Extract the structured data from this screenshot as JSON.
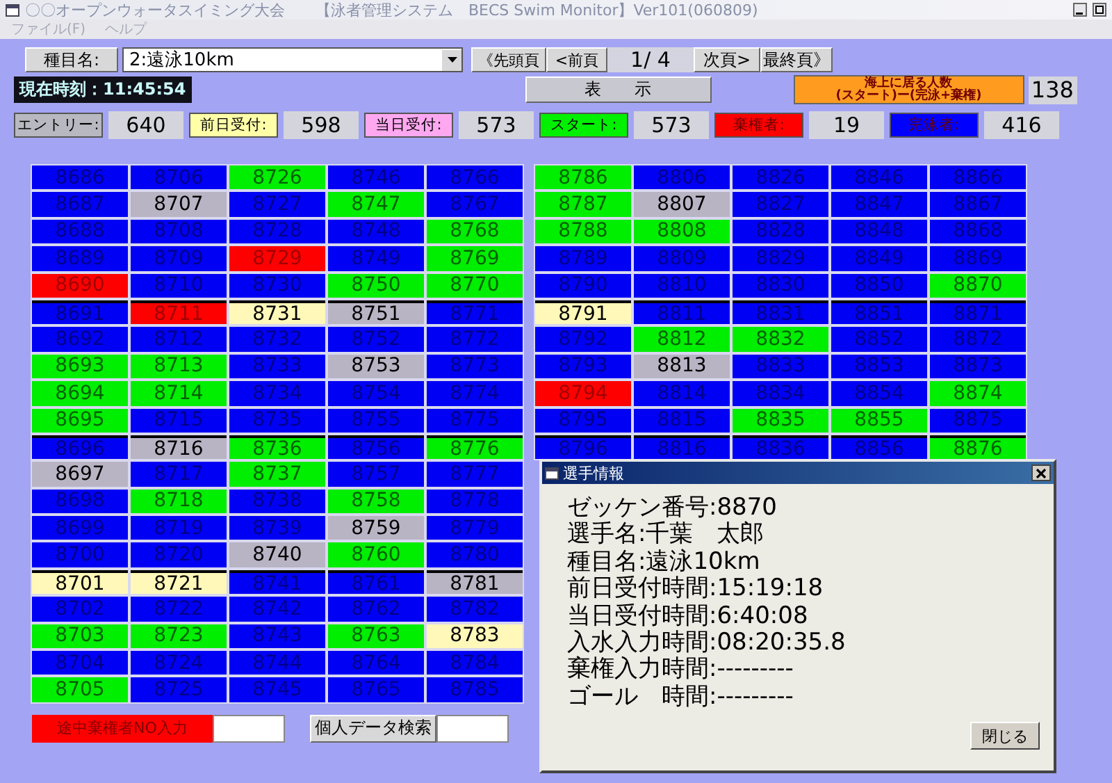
{
  "window": {
    "title": "〇〇オープンウォータスイミング大会　　【泳者管理システム　BECS Swim Monitor】Ver101(060809)"
  },
  "menu": [
    "ファイル(F)",
    "ヘルプ"
  ],
  "event": {
    "label": "種目名:",
    "value": "2:遠泳10km"
  },
  "clock": {
    "label": "現在時刻：",
    "value": "11:45:54"
  },
  "pager": {
    "first": "《先頭頁",
    "prev": "<前頁",
    "page": "1/ 4",
    "next": "次頁>",
    "last": "最終頁》",
    "show": "表　　示"
  },
  "at_sea": {
    "title": "海上に居る人数",
    "subtitle": "(スタート)ー(完泳+棄権)",
    "value": "138"
  },
  "stats": [
    {
      "label": "エントリー:",
      "value": "640",
      "color": "#b8b8c0"
    },
    {
      "label": "前日受付:",
      "value": "598",
      "color": "#ffffa8"
    },
    {
      "label": "当日受付:",
      "value": "573",
      "color": "#ffa8f0"
    },
    {
      "label": "スタート:",
      "value": "573",
      "color": "#00f000"
    },
    {
      "label": "棄権者:",
      "value": "19",
      "color": "#ff0000"
    },
    {
      "label": "完泳者:",
      "value": "416",
      "color": "#0000ff"
    }
  ],
  "grids": [
    {
      "rows": [
        [
          {
            "text": "8686",
            "kind": "finished"
          },
          {
            "text": "8706",
            "kind": "finished"
          },
          {
            "text": "8726",
            "kind": "started"
          },
          {
            "text": "8746",
            "kind": "finished"
          },
          {
            "text": "8766",
            "kind": "finished"
          }
        ],
        [
          {
            "text": "8687",
            "kind": "finished"
          },
          {
            "text": "8707",
            "kind": "entry"
          },
          {
            "text": "8727",
            "kind": "finished"
          },
          {
            "text": "8747",
            "kind": "started"
          },
          {
            "text": "8767",
            "kind": "finished"
          }
        ],
        [
          {
            "text": "8688",
            "kind": "finished"
          },
          {
            "text": "8708",
            "kind": "finished"
          },
          {
            "text": "8728",
            "kind": "finished"
          },
          {
            "text": "8748",
            "kind": "finished"
          },
          {
            "text": "8768",
            "kind": "started"
          }
        ],
        [
          {
            "text": "8689",
            "kind": "finished"
          },
          {
            "text": "8709",
            "kind": "finished"
          },
          {
            "text": "8729",
            "kind": "withdrawn"
          },
          {
            "text": "8749",
            "kind": "finished"
          },
          {
            "text": "8769",
            "kind": "started"
          }
        ],
        [
          {
            "text": "8690",
            "kind": "withdrawn"
          },
          {
            "text": "8710",
            "kind": "finished"
          },
          {
            "text": "8730",
            "kind": "finished"
          },
          {
            "text": "8750",
            "kind": "started"
          },
          {
            "text": "8770",
            "kind": "started"
          }
        ],
        [
          {
            "text": "8691",
            "kind": "finished"
          },
          {
            "text": "8711",
            "kind": "withdrawn"
          },
          {
            "text": "8731",
            "kind": "prev_day"
          },
          {
            "text": "8751",
            "kind": "entry"
          },
          {
            "text": "8771",
            "kind": "finished"
          }
        ],
        [
          {
            "text": "8692",
            "kind": "finished"
          },
          {
            "text": "8712",
            "kind": "finished"
          },
          {
            "text": "8732",
            "kind": "finished"
          },
          {
            "text": "8752",
            "kind": "finished"
          },
          {
            "text": "8772",
            "kind": "finished"
          }
        ],
        [
          {
            "text": "8693",
            "kind": "started"
          },
          {
            "text": "8713",
            "kind": "started"
          },
          {
            "text": "8733",
            "kind": "finished"
          },
          {
            "text": "8753",
            "kind": "entry"
          },
          {
            "text": "8773",
            "kind": "finished"
          }
        ],
        [
          {
            "text": "8694",
            "kind": "started"
          },
          {
            "text": "8714",
            "kind": "started"
          },
          {
            "text": "8734",
            "kind": "finished"
          },
          {
            "text": "8754",
            "kind": "finished"
          },
          {
            "text": "8774",
            "kind": "finished"
          }
        ],
        [
          {
            "text": "8695",
            "kind": "started"
          },
          {
            "text": "8715",
            "kind": "finished"
          },
          {
            "text": "8735",
            "kind": "finished"
          },
          {
            "text": "8755",
            "kind": "finished"
          },
          {
            "text": "8775",
            "kind": "finished"
          }
        ],
        [
          {
            "text": "8696",
            "kind": "finished"
          },
          {
            "text": "8716",
            "kind": "entry"
          },
          {
            "text": "8736",
            "kind": "started"
          },
          {
            "text": "8756",
            "kind": "finished"
          },
          {
            "text": "8776",
            "kind": "started"
          }
        ],
        [
          {
            "text": "8697",
            "kind": "entry"
          },
          {
            "text": "8717",
            "kind": "finished"
          },
          {
            "text": "8737",
            "kind": "started"
          },
          {
            "text": "8757",
            "kind": "finished"
          },
          {
            "text": "8777",
            "kind": "finished"
          }
        ],
        [
          {
            "text": "8698",
            "kind": "finished"
          },
          {
            "text": "8718",
            "kind": "started"
          },
          {
            "text": "8738",
            "kind": "finished"
          },
          {
            "text": "8758",
            "kind": "started"
          },
          {
            "text": "8778",
            "kind": "finished"
          }
        ],
        [
          {
            "text": "8699",
            "kind": "finished"
          },
          {
            "text": "8719",
            "kind": "finished"
          },
          {
            "text": "8739",
            "kind": "finished"
          },
          {
            "text": "8759",
            "kind": "entry"
          },
          {
            "text": "8779",
            "kind": "finished"
          }
        ],
        [
          {
            "text": "8700",
            "kind": "finished"
          },
          {
            "text": "8720",
            "kind": "finished"
          },
          {
            "text": "8740",
            "kind": "entry"
          },
          {
            "text": "8760",
            "kind": "started"
          },
          {
            "text": "8780",
            "kind": "finished"
          }
        ],
        [
          {
            "text": "8701",
            "kind": "prev_day"
          },
          {
            "text": "8721",
            "kind": "prev_day"
          },
          {
            "text": "8741",
            "kind": "finished"
          },
          {
            "text": "8761",
            "kind": "finished"
          },
          {
            "text": "8781",
            "kind": "entry"
          }
        ],
        [
          {
            "text": "8702",
            "kind": "finished"
          },
          {
            "text": "8722",
            "kind": "finished"
          },
          {
            "text": "8742",
            "kind": "finished"
          },
          {
            "text": "8762",
            "kind": "finished"
          },
          {
            "text": "8782",
            "kind": "finished"
          }
        ],
        [
          {
            "text": "8703",
            "kind": "started"
          },
          {
            "text": "8723",
            "kind": "started"
          },
          {
            "text": "8743",
            "kind": "finished"
          },
          {
            "text": "8763",
            "kind": "started"
          },
          {
            "text": "8783",
            "kind": "prev_day"
          }
        ],
        [
          {
            "text": "8704",
            "kind": "finished"
          },
          {
            "text": "8724",
            "kind": "finished"
          },
          {
            "text": "8744",
            "kind": "finished"
          },
          {
            "text": "8764",
            "kind": "finished"
          },
          {
            "text": "8784",
            "kind": "finished"
          }
        ],
        [
          {
            "text": "8705",
            "kind": "started"
          },
          {
            "text": "8725",
            "kind": "finished"
          },
          {
            "text": "8745",
            "kind": "finished"
          },
          {
            "text": "8765",
            "kind": "finished"
          },
          {
            "text": "8785",
            "kind": "finished"
          }
        ]
      ]
    },
    {
      "rows": [
        [
          {
            "text": "8786",
            "kind": "started"
          },
          {
            "text": "8806",
            "kind": "finished"
          },
          {
            "text": "8826",
            "kind": "finished"
          },
          {
            "text": "8846",
            "kind": "finished"
          },
          {
            "text": "8866",
            "kind": "finished"
          }
        ],
        [
          {
            "text": "8787",
            "kind": "started"
          },
          {
            "text": "8807",
            "kind": "entry"
          },
          {
            "text": "8827",
            "kind": "finished"
          },
          {
            "text": "8847",
            "kind": "finished"
          },
          {
            "text": "8867",
            "kind": "finished"
          }
        ],
        [
          {
            "text": "8788",
            "kind": "started"
          },
          {
            "text": "8808",
            "kind": "started"
          },
          {
            "text": "8828",
            "kind": "finished"
          },
          {
            "text": "8848",
            "kind": "finished"
          },
          {
            "text": "8868",
            "kind": "finished"
          }
        ],
        [
          {
            "text": "8789",
            "kind": "finished"
          },
          {
            "text": "8809",
            "kind": "finished"
          },
          {
            "text": "8829",
            "kind": "finished"
          },
          {
            "text": "8849",
            "kind": "finished"
          },
          {
            "text": "8869",
            "kind": "finished"
          }
        ],
        [
          {
            "text": "8790",
            "kind": "finished"
          },
          {
            "text": "8810",
            "kind": "finished"
          },
          {
            "text": "8830",
            "kind": "finished"
          },
          {
            "text": "8850",
            "kind": "finished"
          },
          {
            "text": "8870",
            "kind": "started"
          }
        ],
        [
          {
            "text": "8791",
            "kind": "prev_day"
          },
          {
            "text": "8811",
            "kind": "finished"
          },
          {
            "text": "8831",
            "kind": "finished"
          },
          {
            "text": "8851",
            "kind": "finished"
          },
          {
            "text": "8871",
            "kind": "finished"
          }
        ],
        [
          {
            "text": "8792",
            "kind": "finished"
          },
          {
            "text": "8812",
            "kind": "started"
          },
          {
            "text": "8832",
            "kind": "started"
          },
          {
            "text": "8852",
            "kind": "finished"
          },
          {
            "text": "8872",
            "kind": "finished"
          }
        ],
        [
          {
            "text": "8793",
            "kind": "finished"
          },
          {
            "text": "8813",
            "kind": "entry"
          },
          {
            "text": "8833",
            "kind": "finished"
          },
          {
            "text": "8853",
            "kind": "finished"
          },
          {
            "text": "8873",
            "kind": "finished"
          }
        ],
        [
          {
            "text": "8794",
            "kind": "withdrawn"
          },
          {
            "text": "8814",
            "kind": "finished"
          },
          {
            "text": "8834",
            "kind": "finished"
          },
          {
            "text": "8854",
            "kind": "finished"
          },
          {
            "text": "8874",
            "kind": "started"
          }
        ],
        [
          {
            "text": "8795",
            "kind": "finished"
          },
          {
            "text": "8815",
            "kind": "finished"
          },
          {
            "text": "8835",
            "kind": "started"
          },
          {
            "text": "8855",
            "kind": "started"
          },
          {
            "text": "8875",
            "kind": "finished"
          }
        ],
        [
          {
            "text": "8796",
            "kind": "finished"
          },
          {
            "text": "8816",
            "kind": "finished"
          },
          {
            "text": "8836",
            "kind": "finished"
          },
          {
            "text": "8856",
            "kind": "finished"
          },
          {
            "text": "8876",
            "kind": "started"
          }
        ]
      ]
    }
  ],
  "withdraw_input": {
    "label": "途中棄権者NO入力"
  },
  "search": {
    "button": "個人データ検索"
  },
  "dialog": {
    "title": "選手情報",
    "lines": [
      "ゼッケン番号:8870",
      "選手名:千葉　太郎",
      "種目名:遠泳10km",
      "前日受付時間:15:19:18",
      "当日受付時間:6:40:08",
      "入水入力時間:08:20:35.8",
      "棄権入力時間:---------",
      "ゴール　時間:---------"
    ],
    "close": "閉じる"
  }
}
